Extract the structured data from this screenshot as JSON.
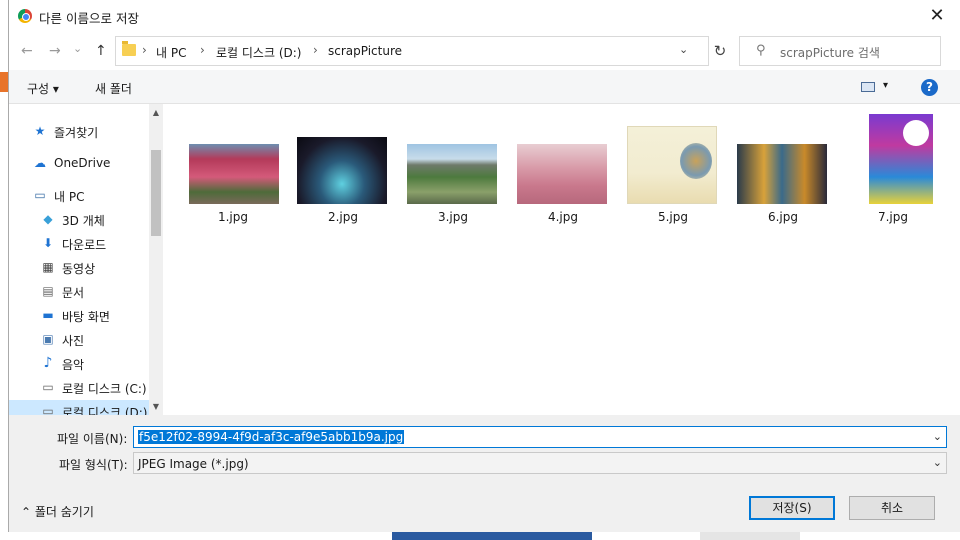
{
  "dialog": {
    "title": "다른 이름으로 저장",
    "close_glyph": "✕"
  },
  "nav": {
    "back_glyph": "←",
    "forward_glyph": "→",
    "dropdown_glyph": "⌄",
    "up_glyph": "↑"
  },
  "address": {
    "crumbs": [
      "내 PC",
      "로컬 디스크 (D:)",
      "scrapPicture"
    ],
    "sep": "›",
    "dropdown_glyph": "⌄",
    "refresh_glyph": "↻"
  },
  "search": {
    "placeholder": "scrapPicture 검색",
    "icon_glyph": "⚲"
  },
  "toolbar": {
    "organize_label": "구성 ▾",
    "new_folder_label": "새 폴더",
    "view_dd_glyph": "▾",
    "help_glyph": "?"
  },
  "sidebar": {
    "items": [
      {
        "label": "즐겨찾기",
        "icon": "★",
        "icon_name": "star-icon"
      },
      {
        "label": "OneDrive",
        "icon": "☁",
        "icon_name": "cloud-icon"
      },
      {
        "label": "내 PC",
        "icon": "▭",
        "icon_name": "computer-icon"
      },
      {
        "label": "3D 개체",
        "icon": "◆",
        "icon_name": "cube-icon"
      },
      {
        "label": "다운로드",
        "icon": "⬇",
        "icon_name": "download-icon"
      },
      {
        "label": "동영상",
        "icon": "▦",
        "icon_name": "film-icon"
      },
      {
        "label": "문서",
        "icon": "▤",
        "icon_name": "document-icon"
      },
      {
        "label": "바탕 화면",
        "icon": "▬",
        "icon_name": "desktop-icon"
      },
      {
        "label": "사진",
        "icon": "▣",
        "icon_name": "picture-icon"
      },
      {
        "label": "음악",
        "icon": "♪",
        "icon_name": "music-icon"
      },
      {
        "label": "로컬 디스크 (C:)",
        "icon": "▭",
        "icon_name": "drive-icon"
      },
      {
        "label": "로컬 디스크 (D:)",
        "icon": "▭",
        "icon_name": "drive-icon"
      }
    ],
    "scroll_up_glyph": "▲",
    "scroll_down_glyph": "▼"
  },
  "files": [
    {
      "name": "1.jpg"
    },
    {
      "name": "2.jpg"
    },
    {
      "name": "3.jpg"
    },
    {
      "name": "4.jpg"
    },
    {
      "name": "5.jpg"
    },
    {
      "name": "6.jpg"
    },
    {
      "name": "7.jpg"
    }
  ],
  "form": {
    "filename_label": "파일 이름(N):",
    "filename_value": "f5e12f02-8994-4f9d-af3c-af9e5abb1b9a.jpg",
    "filetype_label": "파일 형식(T):",
    "filetype_value": "JPEG Image (*.jpg)",
    "dropdown_glyph": "⌄"
  },
  "footer": {
    "hide_folders_label": "⌃  폴더 숨기기",
    "save_label": "저장(S)",
    "cancel_label": "취소"
  }
}
